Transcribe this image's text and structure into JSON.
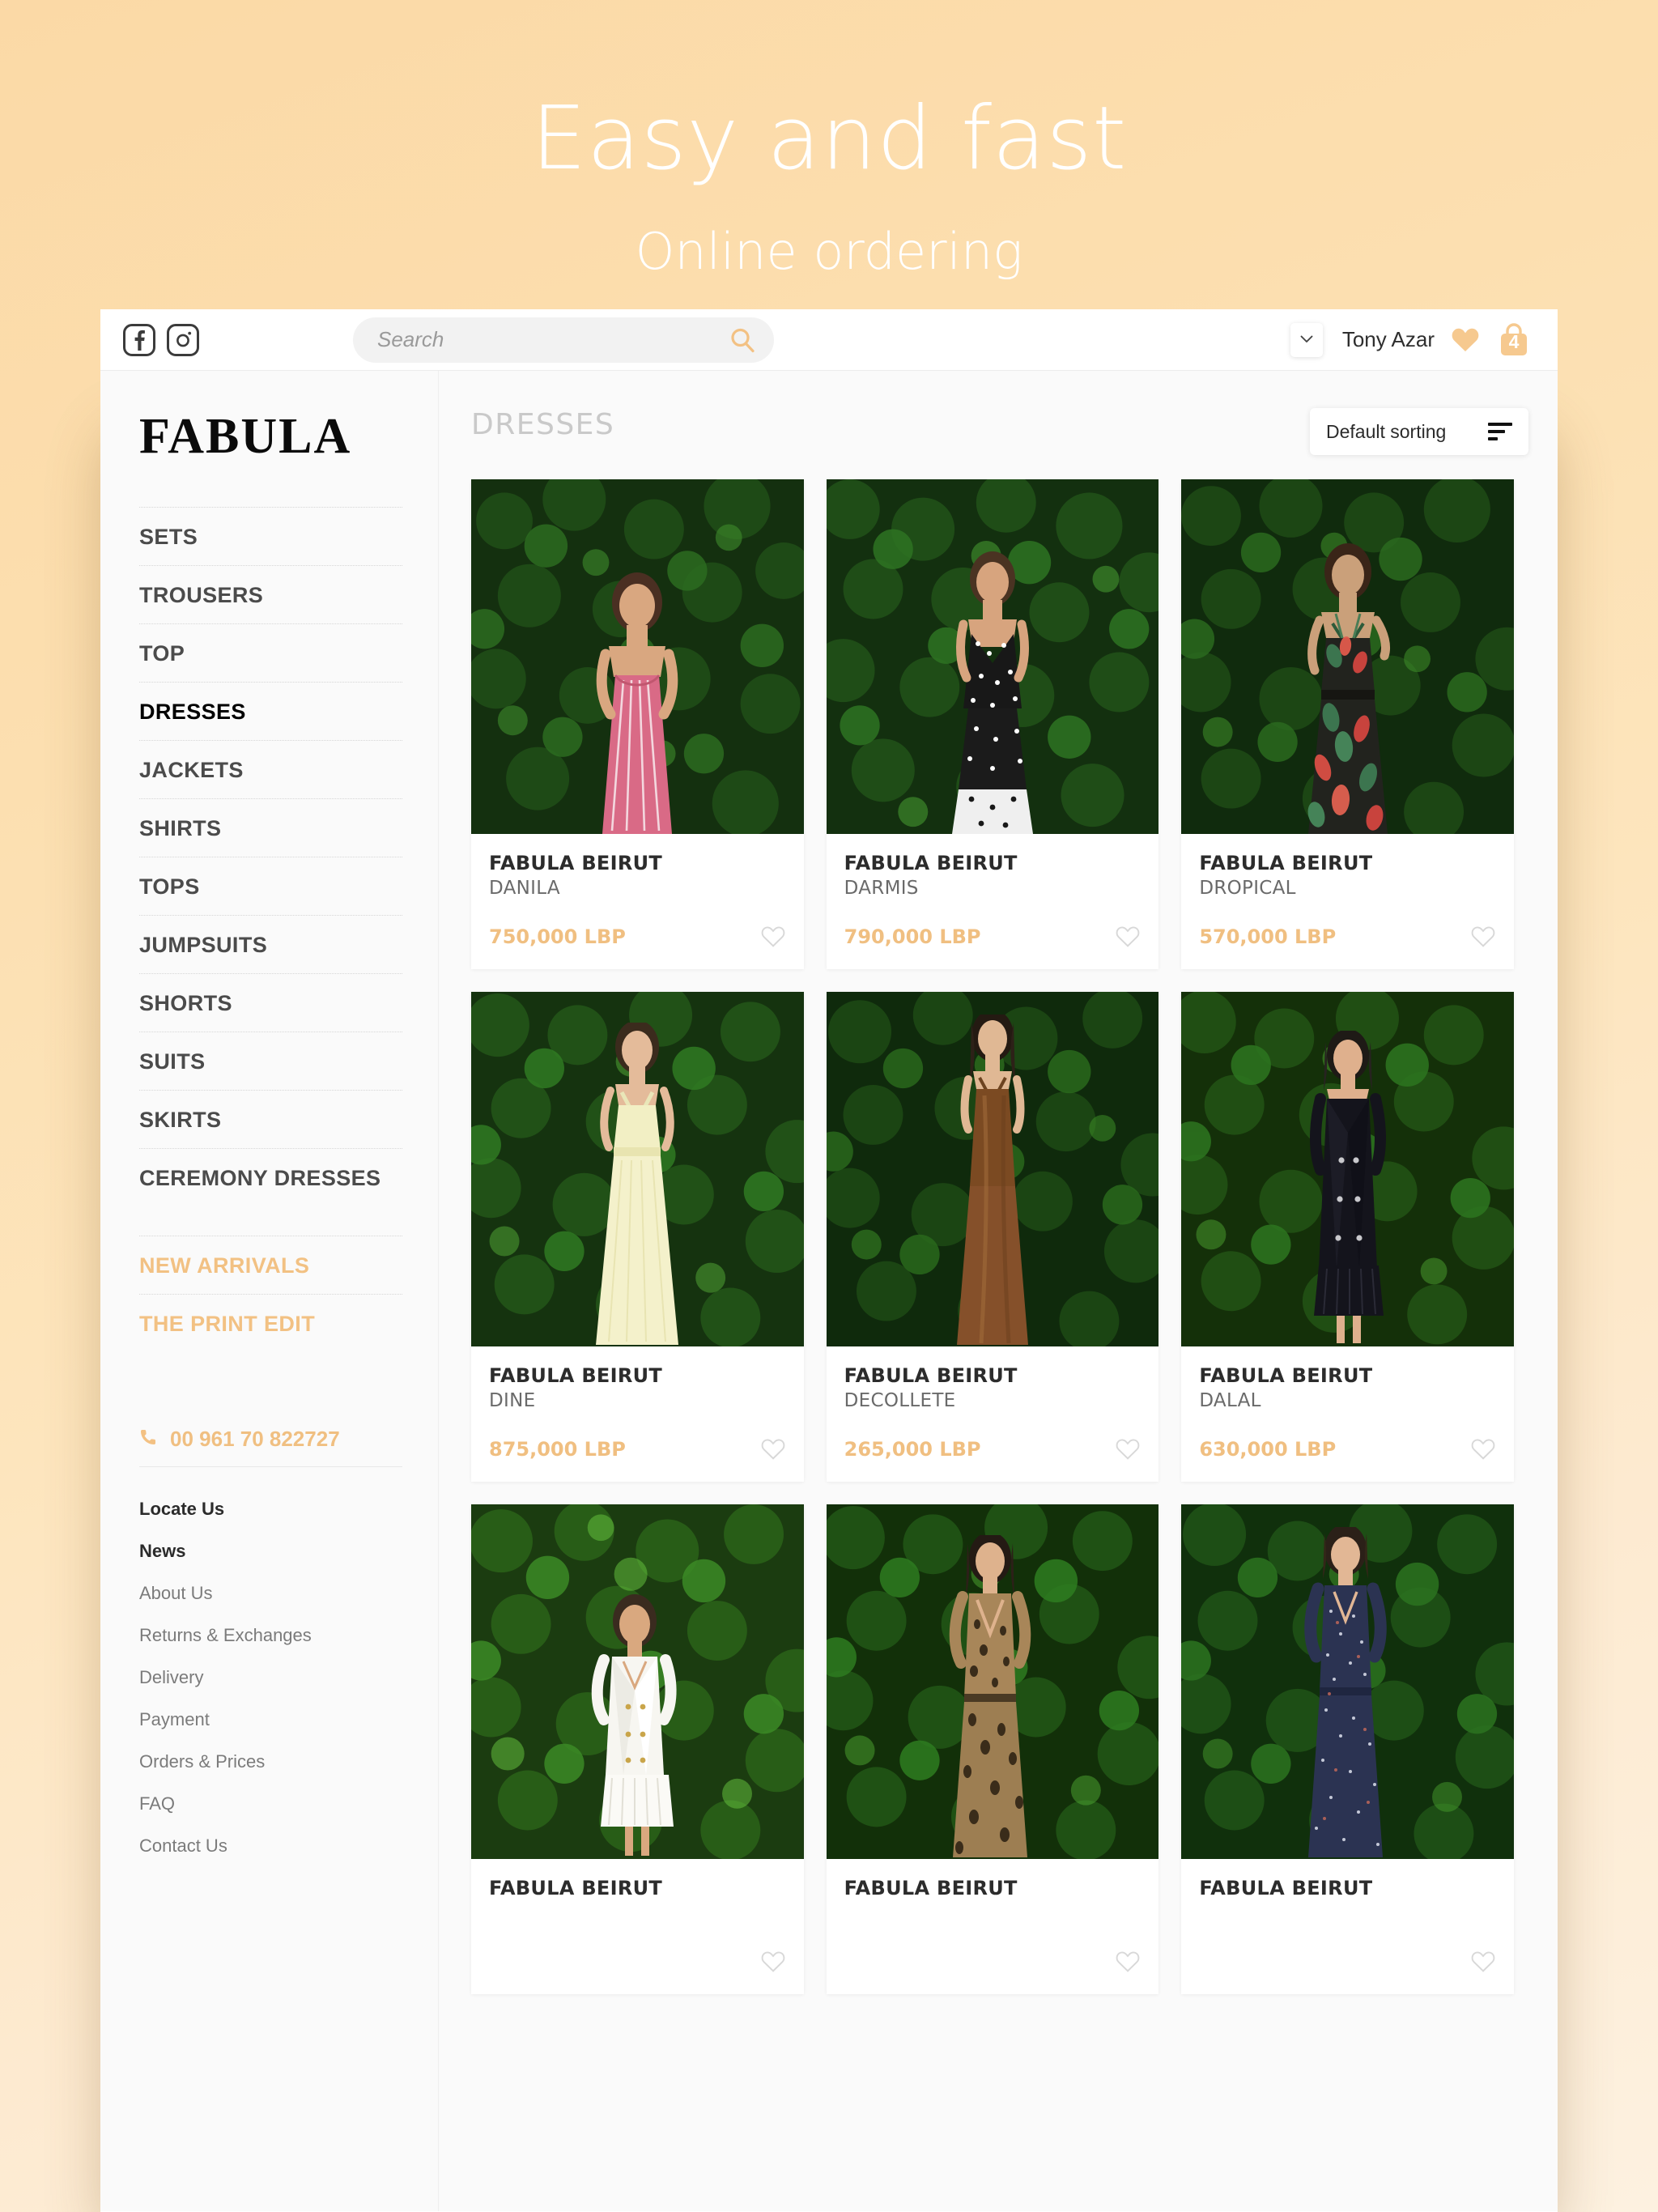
{
  "promo": {
    "title": "Easy and fast",
    "subtitle": "Online ordering"
  },
  "colors": {
    "accent": "#f0bf81",
    "background": "#fbd9a6",
    "text_dark": "#2c2c2c",
    "text_muted": "#7b7b7b",
    "page_title": "#c9c9c9"
  },
  "topbar": {
    "facebook_icon": "facebook-icon",
    "instagram_icon": "instagram-icon",
    "search": {
      "value": "",
      "placeholder": "Search",
      "icon": "search-icon"
    },
    "account": {
      "caret_icon": "chevron-down-icon",
      "name": "Tony Azar"
    },
    "wishlist_icon": "heart-icon",
    "cart": {
      "icon": "shopping-bag-icon",
      "count": "4"
    }
  },
  "sidebar": {
    "logo": "FABULA",
    "categories": [
      {
        "label": "SETS",
        "active": false,
        "accent": false
      },
      {
        "label": "TROUSERS",
        "active": false,
        "accent": false
      },
      {
        "label": "TOP",
        "active": false,
        "accent": false
      },
      {
        "label": "DRESSES",
        "active": true,
        "accent": false
      },
      {
        "label": "JACKETS",
        "active": false,
        "accent": false
      },
      {
        "label": "SHIRTS",
        "active": false,
        "accent": false
      },
      {
        "label": "TOPS",
        "active": false,
        "accent": false
      },
      {
        "label": "JUMPSUITS",
        "active": false,
        "accent": false
      },
      {
        "label": "SHORTS",
        "active": false,
        "accent": false
      },
      {
        "label": "SUITS",
        "active": false,
        "accent": false
      },
      {
        "label": "SKIRTS",
        "active": false,
        "accent": false
      },
      {
        "label": "CEREMONY DRESSES",
        "active": false,
        "accent": false
      }
    ],
    "promos": [
      {
        "label": "NEW ARRIVALS"
      },
      {
        "label": "THE PRINT EDIT"
      }
    ],
    "phone": {
      "icon": "phone-icon",
      "number": "00 961 70 822727"
    },
    "footer_links": [
      {
        "label": "Locate Us",
        "strong": true
      },
      {
        "label": "News",
        "strong": true
      },
      {
        "label": "About Us",
        "strong": false
      },
      {
        "label": "Returns & Exchanges",
        "strong": false
      },
      {
        "label": "Delivery",
        "strong": false
      },
      {
        "label": "Payment",
        "strong": false
      },
      {
        "label": "Orders & Prices",
        "strong": false
      },
      {
        "label": "FAQ",
        "strong": false
      },
      {
        "label": "Contact Us",
        "strong": false
      }
    ]
  },
  "main": {
    "page_title": "DRESSES",
    "sorting": {
      "label": "Default sorting",
      "icon": "sort-icon"
    },
    "products": [
      {
        "brand": "FABULA BEIRUT",
        "name": "DANILA",
        "price": "750,000 LBP",
        "fav_icon": "heart-outline-icon",
        "dress_color": "#d96a86",
        "dress_style": "striped-gown"
      },
      {
        "brand": "FABULA BEIRUT",
        "name": "DARMIS",
        "price": "790,000 LBP",
        "fav_icon": "heart-outline-icon",
        "dress_color": "#1d1d1d",
        "dress_style": "polkadot-gown"
      },
      {
        "brand": "FABULA BEIRUT",
        "name": "DROPICAL",
        "price": "570,000 LBP",
        "fav_icon": "heart-outline-icon",
        "dress_color": "#2a2a26",
        "dress_style": "floral-gown"
      },
      {
        "brand": "FABULA BEIRUT",
        "name": "DINE",
        "price": "875,000 LBP",
        "fav_icon": "heart-outline-icon",
        "dress_color": "#f2efc4",
        "dress_style": "cream-gown"
      },
      {
        "brand": "FABULA BEIRUT",
        "name": "DECOLLETE",
        "price": "265,000 LBP",
        "fav_icon": "heart-outline-icon",
        "dress_color": "#7b4a22",
        "dress_style": "satin-slip"
      },
      {
        "brand": "FABULA BEIRUT",
        "name": "DALAL",
        "price": "630,000 LBP",
        "fav_icon": "heart-outline-icon",
        "dress_color": "#14141c",
        "dress_style": "black-coat"
      },
      {
        "brand": "FABULA BEIRUT",
        "name": "",
        "price": "",
        "fav_icon": "heart-outline-icon",
        "dress_color": "#f7f6f1",
        "dress_style": "white-blazer"
      },
      {
        "brand": "FABULA BEIRUT",
        "name": "",
        "price": "",
        "fav_icon": "heart-outline-icon",
        "dress_color": "#9a7a4f",
        "dress_style": "leopard-gown"
      },
      {
        "brand": "FABULA BEIRUT",
        "name": "",
        "price": "",
        "fav_icon": "heart-outline-icon",
        "dress_color": "#2b3352",
        "dress_style": "navy-floral"
      }
    ]
  }
}
